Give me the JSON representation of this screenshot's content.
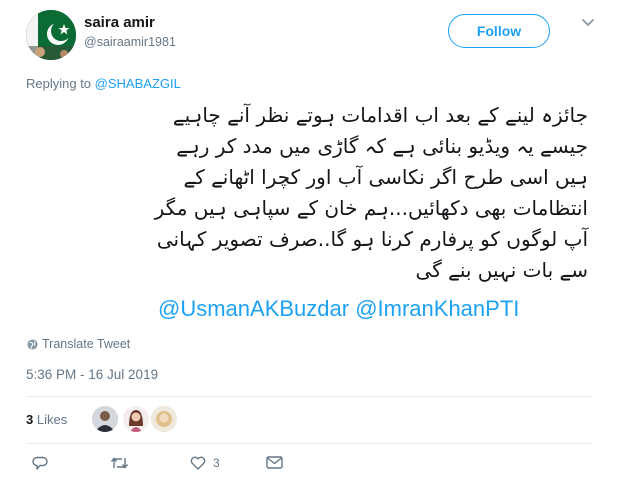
{
  "author": {
    "name": "saira amir",
    "handle": "@sairaamir1981",
    "avatar_icon": "pakistan-flag-avatar"
  },
  "follow_button": {
    "label": "Follow"
  },
  "reply_context": {
    "prefix": "Replying to",
    "mention": "@SHABAZGIL"
  },
  "tweet": {
    "lines": [
      "جائزہ لینے کے بعد اب اقدامات ہوتے نظر آنے چاہیے",
      "جیسے یہ ویڈیو بنائی ہے کہ گاڑی میں مدد کر رہے",
      "ہیں اسی طرح اگر نکاسی آب اور کچرا اٹھانے کے",
      "انتظامات بھی دکھائیں...ہم خان کے سپاہی ہیں مگر",
      "آپ لوگوں کو پرفارم کرنا ہو گا..صرف تصویر کہانی",
      "سے بات نہیں بنے گی"
    ],
    "mentions": [
      "@UsmanAKBuzdar",
      "@ImranKhanPTI"
    ]
  },
  "translate": {
    "label": "Translate Tweet"
  },
  "timestamp": "5:36 PM - 16 Jul 2019",
  "stats": {
    "likes_count": "3",
    "likes_label": "Likes"
  },
  "actions": {
    "reply_icon": "reply-icon",
    "retweet_icon": "retweet-icon",
    "like_icon": "heart-icon",
    "like_count": "3",
    "dm_icon": "envelope-icon"
  },
  "colors": {
    "accent": "#1da1f2",
    "secondary_text": "#657786",
    "primary_text": "#14171a",
    "divider": "#e6ecf0"
  }
}
